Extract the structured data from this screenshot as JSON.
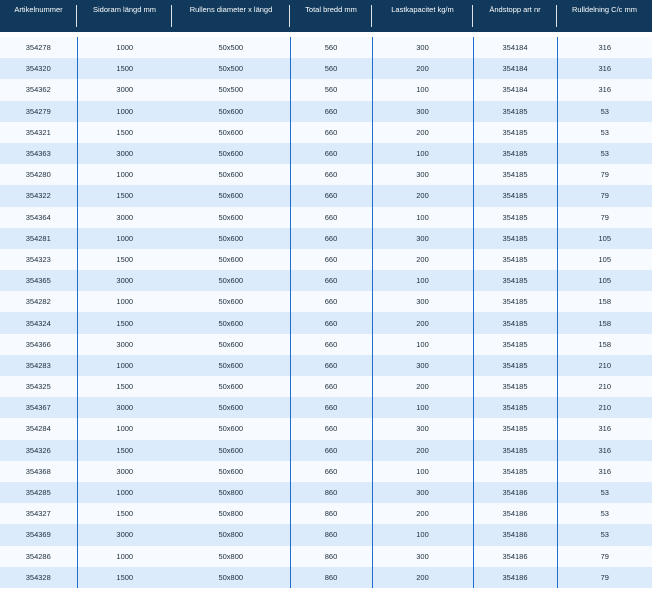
{
  "table": {
    "headers": [
      "Artikelnummer",
      "Sidoram längd mm",
      "Rullens diameter x längd",
      "Total bredd mm",
      "Lastkapacitet kg/m",
      "Ändstopp art nr",
      "Rulldelning C/c mm"
    ],
    "rows": [
      [
        "354278",
        "1000",
        "50x500",
        "560",
        "300",
        "354184",
        "316"
      ],
      [
        "354320",
        "1500",
        "50x500",
        "560",
        "200",
        "354184",
        "316"
      ],
      [
        "354362",
        "3000",
        "50x500",
        "560",
        "100",
        "354184",
        "316"
      ],
      [
        "354279",
        "1000",
        "50x600",
        "660",
        "300",
        "354185",
        "53"
      ],
      [
        "354321",
        "1500",
        "50x600",
        "660",
        "200",
        "354185",
        "53"
      ],
      [
        "354363",
        "3000",
        "50x600",
        "660",
        "100",
        "354185",
        "53"
      ],
      [
        "354280",
        "1000",
        "50x600",
        "660",
        "300",
        "354185",
        "79"
      ],
      [
        "354322",
        "1500",
        "50x600",
        "660",
        "200",
        "354185",
        "79"
      ],
      [
        "354364",
        "3000",
        "50x600",
        "660",
        "100",
        "354185",
        "79"
      ],
      [
        "354281",
        "1000",
        "50x600",
        "660",
        "300",
        "354185",
        "105"
      ],
      [
        "354323",
        "1500",
        "50x600",
        "660",
        "200",
        "354185",
        "105"
      ],
      [
        "354365",
        "3000",
        "50x600",
        "660",
        "100",
        "354185",
        "105"
      ],
      [
        "354282",
        "1000",
        "50x600",
        "660",
        "300",
        "354185",
        "158"
      ],
      [
        "354324",
        "1500",
        "50x600",
        "660",
        "200",
        "354185",
        "158"
      ],
      [
        "354366",
        "3000",
        "50x600",
        "660",
        "100",
        "354185",
        "158"
      ],
      [
        "354283",
        "1000",
        "50x600",
        "660",
        "300",
        "354185",
        "210"
      ],
      [
        "354325",
        "1500",
        "50x600",
        "660",
        "200",
        "354185",
        "210"
      ],
      [
        "354367",
        "3000",
        "50x600",
        "660",
        "100",
        "354185",
        "210"
      ],
      [
        "354284",
        "1000",
        "50x600",
        "660",
        "300",
        "354185",
        "316"
      ],
      [
        "354326",
        "1500",
        "50x600",
        "660",
        "200",
        "354185",
        "316"
      ],
      [
        "354368",
        "3000",
        "50x600",
        "660",
        "100",
        "354185",
        "316"
      ],
      [
        "354285",
        "1000",
        "50x800",
        "860",
        "300",
        "354186",
        "53"
      ],
      [
        "354327",
        "1500",
        "50x800",
        "860",
        "200",
        "354186",
        "53"
      ],
      [
        "354369",
        "3000",
        "50x800",
        "860",
        "100",
        "354186",
        "53"
      ],
      [
        "354286",
        "1000",
        "50x800",
        "860",
        "300",
        "354186",
        "79"
      ],
      [
        "354328",
        "1500",
        "50x800",
        "860",
        "200",
        "354186",
        "79"
      ]
    ]
  },
  "colors": {
    "header_bg": "#10395b",
    "row_light": "#f7fbff",
    "row_dark": "#dcebfb",
    "separator": "#1e6fcf"
  }
}
